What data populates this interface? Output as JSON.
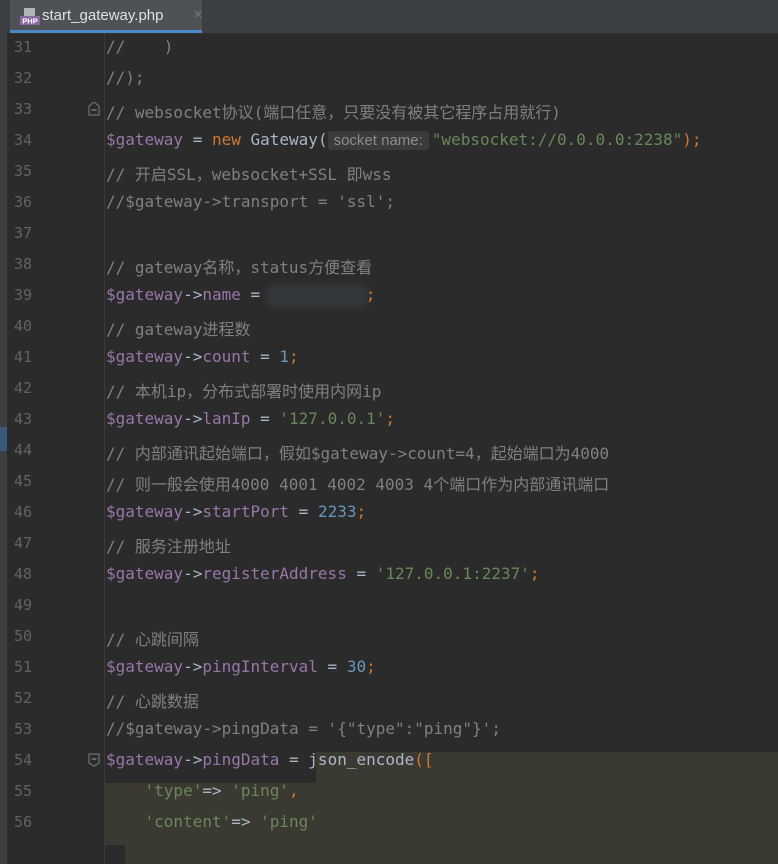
{
  "tab": {
    "filename": "start_gateway.php",
    "close_glyph": "×",
    "file_icon_label": "PHP",
    "icon": "php-file-icon"
  },
  "lines": [
    {
      "n": "31",
      "t": "//    )"
    },
    {
      "n": "32",
      "t": "//);"
    },
    {
      "n": "33",
      "t": "// websocket协议(端口任意，只要没有被其它程序占用就行)"
    },
    {
      "n": "34",
      "v": "$gateway",
      "op": " = ",
      "kw": "new",
      "cls": " Gateway(",
      "hint": "socket name:",
      "str": "\"websocket://0.0.0.0:2238\"",
      "end": ");"
    },
    {
      "n": "35",
      "t": "// 开启SSL，websocket+SSL 即wss"
    },
    {
      "n": "36",
      "t": "//$gateway->transport = 'ssl';"
    },
    {
      "n": "37",
      "t": ""
    },
    {
      "n": "38",
      "t": "// gateway名称，status方便查看"
    },
    {
      "n": "39",
      "v": "$gateway",
      "arrow": "->",
      "prop": "name",
      "op": " = ",
      "end": ";"
    },
    {
      "n": "40",
      "t": "// gateway进程数"
    },
    {
      "n": "41",
      "v": "$gateway",
      "arrow": "->",
      "prop": "count",
      "op": " = ",
      "num": "1",
      "end": ";"
    },
    {
      "n": "42",
      "t": "// 本机ip，分布式部署时使用内网ip"
    },
    {
      "n": "43",
      "v": "$gateway",
      "arrow": "->",
      "prop": "lanIp",
      "op": " = ",
      "str": "'127.0.0.1'",
      "end": ";"
    },
    {
      "n": "44",
      "t": "// 内部通讯起始端口，假如$gateway->count=4，起始端口为4000"
    },
    {
      "n": "45",
      "t": "// 则一般会使用4000 4001 4002 4003 4个端口作为内部通讯端口"
    },
    {
      "n": "46",
      "v": "$gateway",
      "arrow": "->",
      "prop": "startPort",
      "op": " = ",
      "num": "2233",
      "end": ";"
    },
    {
      "n": "47",
      "t": "// 服务注册地址"
    },
    {
      "n": "48",
      "v": "$gateway",
      "arrow": "->",
      "prop": "registerAddress",
      "op": " = ",
      "str": "'127.0.0.1:2237'",
      "end": ";"
    },
    {
      "n": "49",
      "t": ""
    },
    {
      "n": "50",
      "t": "// 心跳间隔"
    },
    {
      "n": "51",
      "v": "$gateway",
      "arrow": "->",
      "prop": "pingInterval",
      "op": " = ",
      "num": "30",
      "end": ";"
    },
    {
      "n": "52",
      "t": "// 心跳数据"
    },
    {
      "n": "53",
      "t": "//$gateway->pingData = '{\"type\":\"ping\"}';"
    },
    {
      "n": "54",
      "v": "$gateway",
      "arrow": "->",
      "prop": "pingData",
      "op": " = ",
      "fn": "json_encode",
      "end": "(["
    },
    {
      "n": "55",
      "indent": "    ",
      "key": "'type'",
      "op": "=> ",
      "str": "'ping'",
      "end": ","
    },
    {
      "n": "56",
      "indent": "    ",
      "key": "'content'",
      "op": "=> ",
      "str": "'ping'"
    }
  ],
  "colors": {
    "background": "#2b2b2b",
    "comment": "#808080",
    "variable": "#9876aa",
    "keyword": "#cc7832",
    "string": "#6a8759",
    "number": "#6897bb",
    "plain": "#a9b7c6",
    "function": "#ffc66d",
    "line_number": "#606366",
    "tab_underline": "#4a88c7"
  }
}
